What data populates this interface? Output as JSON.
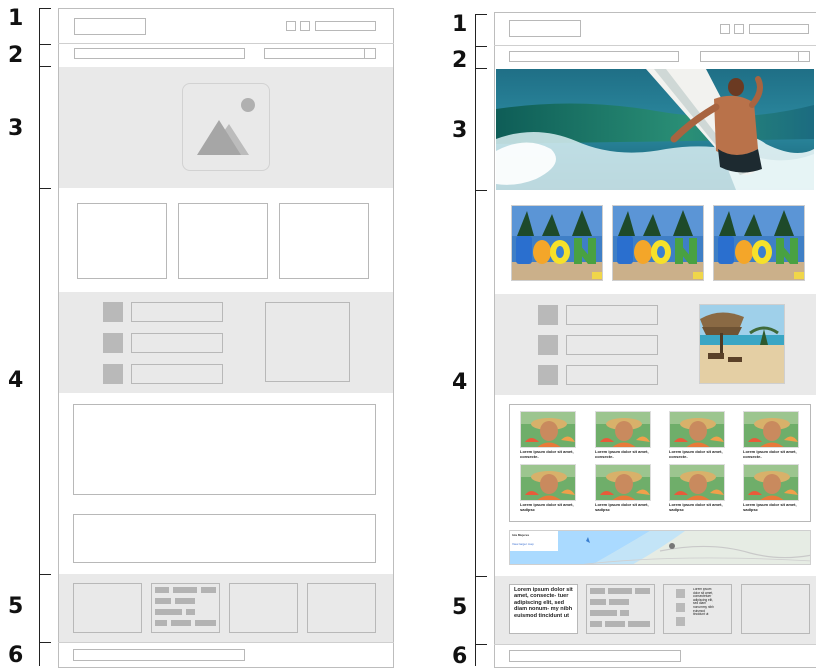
{
  "section_numbers": [
    "1",
    "2",
    "3",
    "4",
    "5",
    "6"
  ],
  "thumb_captions": [
    "Lorem ipsum dolor sit amet, consecte-",
    "Lorem ipsum dolor sit amet, consecte-",
    "Lorem ipsum dolor sit amet, consecte-",
    "Lorem ipsum dolor sit amet, consecte-",
    "Lorem ipsum dolor sit amet, sadipsc",
    "Lorem ipsum dolor sit amet, sadipsc",
    "Lorem ipsum dolor sit amet, sadipsc",
    "Lorem ipsum dolor sit amet, sadipsc"
  ],
  "map": {
    "place_label": "Isla Mujeres",
    "link_text": "View larger map"
  },
  "footer_text": "Lorem ipsum dolor sit amet, consecte- tuer adipiscing elit, sed diam nonum- my nibh euismod tincidunt ut",
  "footer_list_text": "Lorem ipsum dolor sit amet, consectetuer adipiscing elit, sed diam nonummy nibh euismod tincidunt ut",
  "colors": {
    "frame": "#bdbdbd",
    "band": "#e9e9e9",
    "placeholder": "#b3b3b3"
  }
}
